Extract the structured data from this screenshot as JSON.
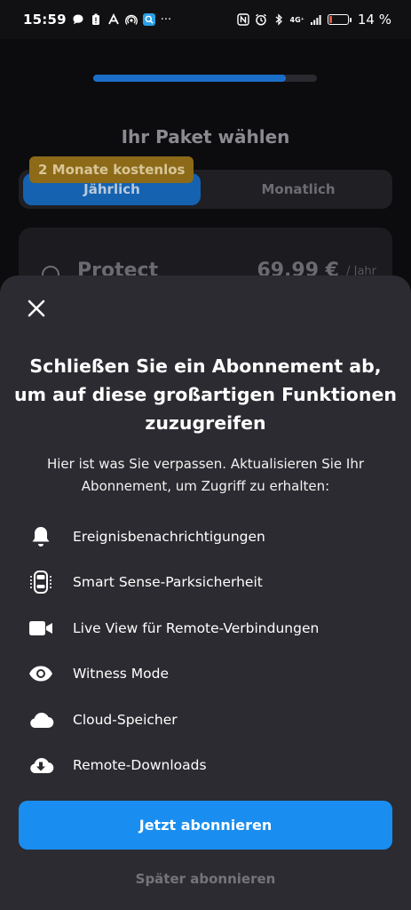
{
  "status_bar": {
    "time": "15:59",
    "more": "···",
    "network": "4G⁺",
    "battery_text": "14 %",
    "battery_level": 0.14
  },
  "background": {
    "progress": 0.86,
    "title": "Ihr Paket wählen",
    "promo_badge": "2 Monate kostenlos",
    "toggle": {
      "yearly": "Jährlich",
      "monthly": "Monatlich",
      "selected": "yearly"
    },
    "plan": {
      "name": "Protect",
      "price": "69,99 €",
      "unit": "/ Jahr"
    }
  },
  "sheet": {
    "title": "Schließen Sie ein Abonnement ab, um auf diese großartigen Funktionen zuzugreifen",
    "subtitle": "Hier ist was Sie verpassen. Aktualisieren Sie Ihr Abonnement, um Zugriff zu erhalten:",
    "features": [
      {
        "icon": "bell-icon",
        "label": "Ereignisbenachrichtigungen"
      },
      {
        "icon": "car-sensor-icon",
        "label": "Smart Sense-Parksicherheit"
      },
      {
        "icon": "video-camera-icon",
        "label": "Live View für Remote-Verbindungen"
      },
      {
        "icon": "eye-icon",
        "label": "Witness Mode"
      },
      {
        "icon": "cloud-icon",
        "label": "Cloud-Speicher"
      },
      {
        "icon": "cloud-download-icon",
        "label": "Remote-Downloads"
      }
    ],
    "primary_button": "Jetzt abonnieren",
    "secondary_link": "Später abonnieren"
  },
  "colors": {
    "accent": "#1a8ef0",
    "sheet_bg": "#2b2b31",
    "promo": "#8c6a18"
  }
}
